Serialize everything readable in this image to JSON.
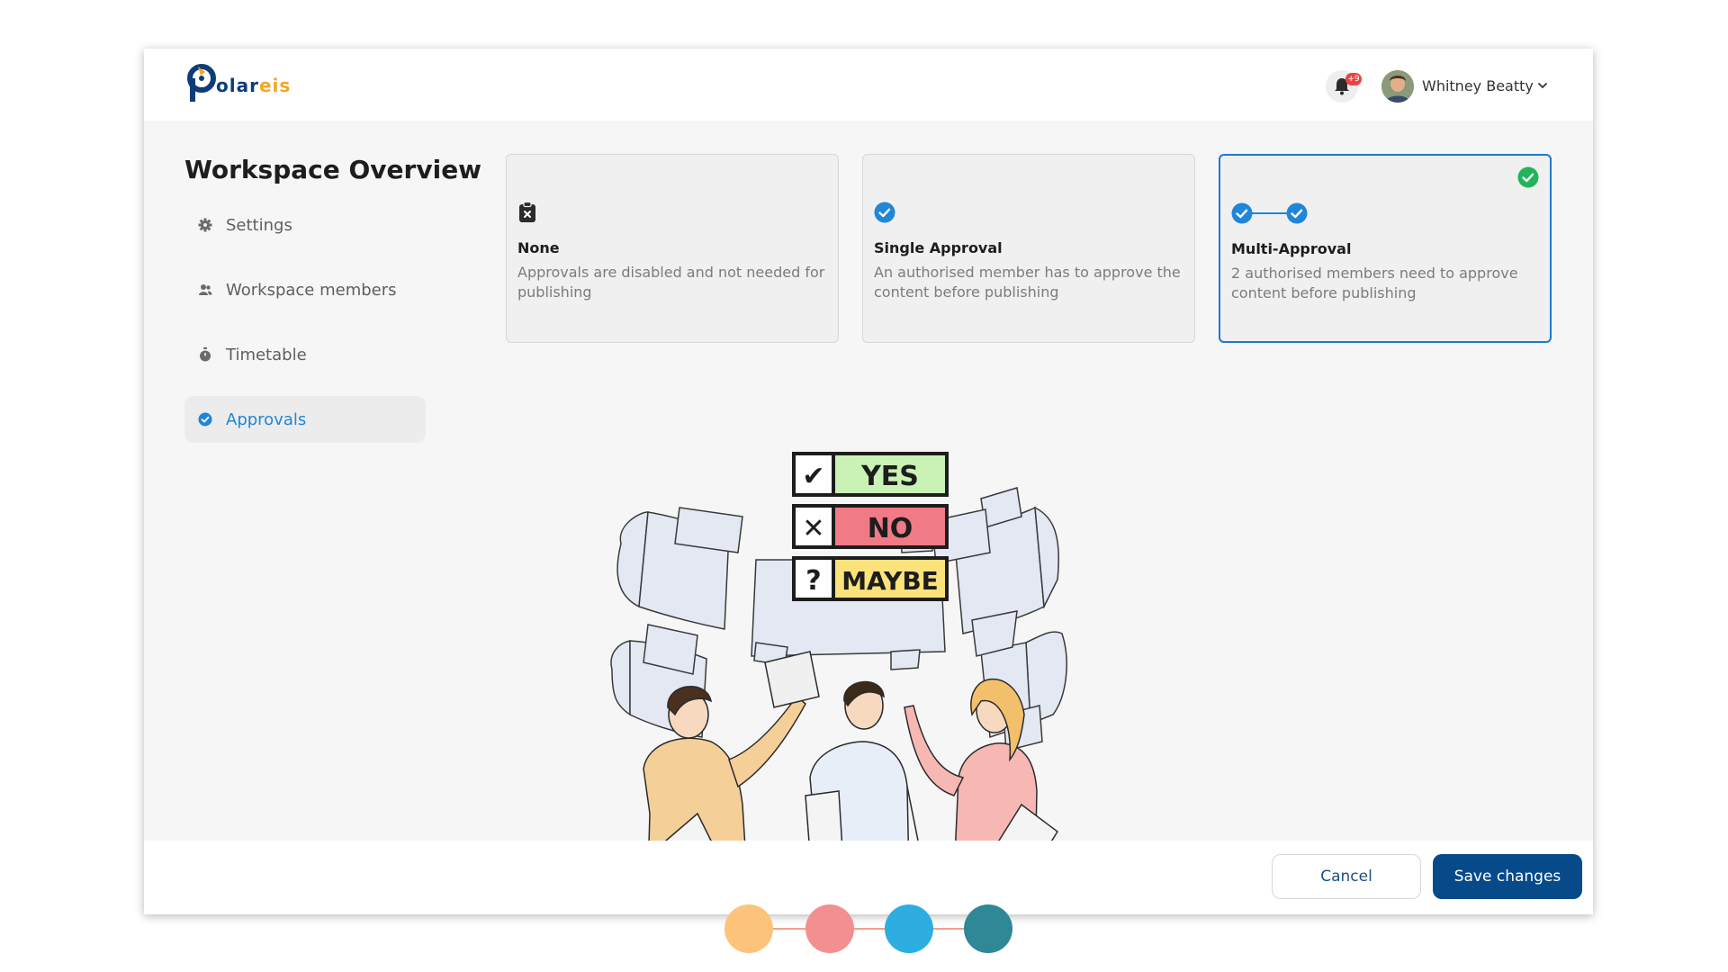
{
  "app": {
    "logo_prefix": "olar",
    "logo_suffix": "eis",
    "notification_count": "+9",
    "user_name": "Whitney Beatty"
  },
  "sidebar": {
    "title": "Workspace Overview",
    "items": [
      {
        "label": "Settings",
        "icon": "gear-icon"
      },
      {
        "label": "Workspace members",
        "icon": "users-icon"
      },
      {
        "label": "Timetable",
        "icon": "stopwatch-icon"
      },
      {
        "label": "Approvals",
        "icon": "check-circle-icon",
        "active": true
      }
    ]
  },
  "approval_options": [
    {
      "title": "None",
      "description": "Approvals are disabled and not needed for publishing",
      "icon": "clipboard-x-icon",
      "selected": false
    },
    {
      "title": "Single Approval",
      "description": "An authorised member has to approve the content before publishing",
      "icon": "check-circle-icon",
      "selected": false
    },
    {
      "title": "Multi-Approval",
      "description": "2 authorised members need to approve content before publishing",
      "icon": "double-check-icon",
      "selected": true
    }
  ],
  "illustration": {
    "labels": [
      "YES",
      "NO",
      "MAYBE"
    ],
    "symbols": [
      "✔",
      "✕",
      "?"
    ]
  },
  "footer": {
    "cancel_label": "Cancel",
    "save_label": "Save changes"
  },
  "colors": {
    "accent": "#1f78d1",
    "primary_button": "#064a8a",
    "selected_check": "#22b45a",
    "badge": "#e64545",
    "palette_dots": [
      "#fdc37a",
      "#f28f8f",
      "#2eaee0",
      "#2e8896"
    ]
  }
}
